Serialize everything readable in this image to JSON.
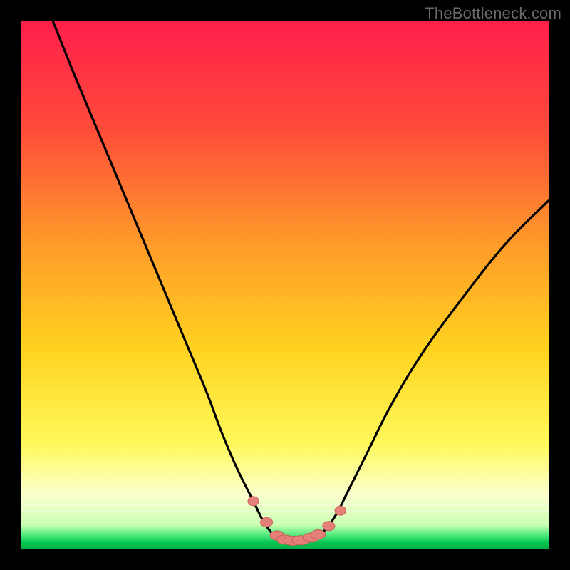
{
  "watermark": {
    "text": "TheBottleneck.com"
  },
  "colors": {
    "top": "#ff1f4b",
    "upper_mid": "#ff7a2d",
    "mid": "#ffd21f",
    "lower_mid": "#fff95a",
    "pale": "#f7ffd6",
    "bottom_green": "#00e05a",
    "bottom_green2": "#00c24f",
    "curve": "#000000",
    "marker_fill": "#e58079",
    "marker_stroke": "#c85f5a"
  },
  "chart_data": {
    "type": "line",
    "title": "",
    "xlabel": "",
    "ylabel": "",
    "xlim": [
      0,
      100
    ],
    "ylim": [
      0,
      100
    ],
    "series": [
      {
        "name": "bottleneck-curve",
        "x": [
          6,
          10,
          15,
          20,
          25,
          30,
          35,
          38,
          41,
          44,
          46,
          48,
          50,
          52,
          54,
          56,
          58,
          60,
          62,
          66,
          70,
          76,
          84,
          92,
          100
        ],
        "y": [
          100,
          90,
          78,
          66,
          54,
          42,
          30,
          22,
          15,
          9,
          5,
          2.5,
          1.5,
          1.3,
          1.5,
          2.2,
          4,
          7,
          11,
          19,
          27,
          37,
          48,
          58,
          66
        ]
      }
    ],
    "markers": {
      "name": "highlight-points",
      "x": [
        44,
        46.5,
        48.5,
        50,
        51.5,
        53,
        55,
        56.3,
        58.3,
        60.5
      ],
      "y": [
        9,
        5,
        2.5,
        1.7,
        1.5,
        1.6,
        2.1,
        2.7,
        4.3,
        7.2
      ]
    }
  }
}
